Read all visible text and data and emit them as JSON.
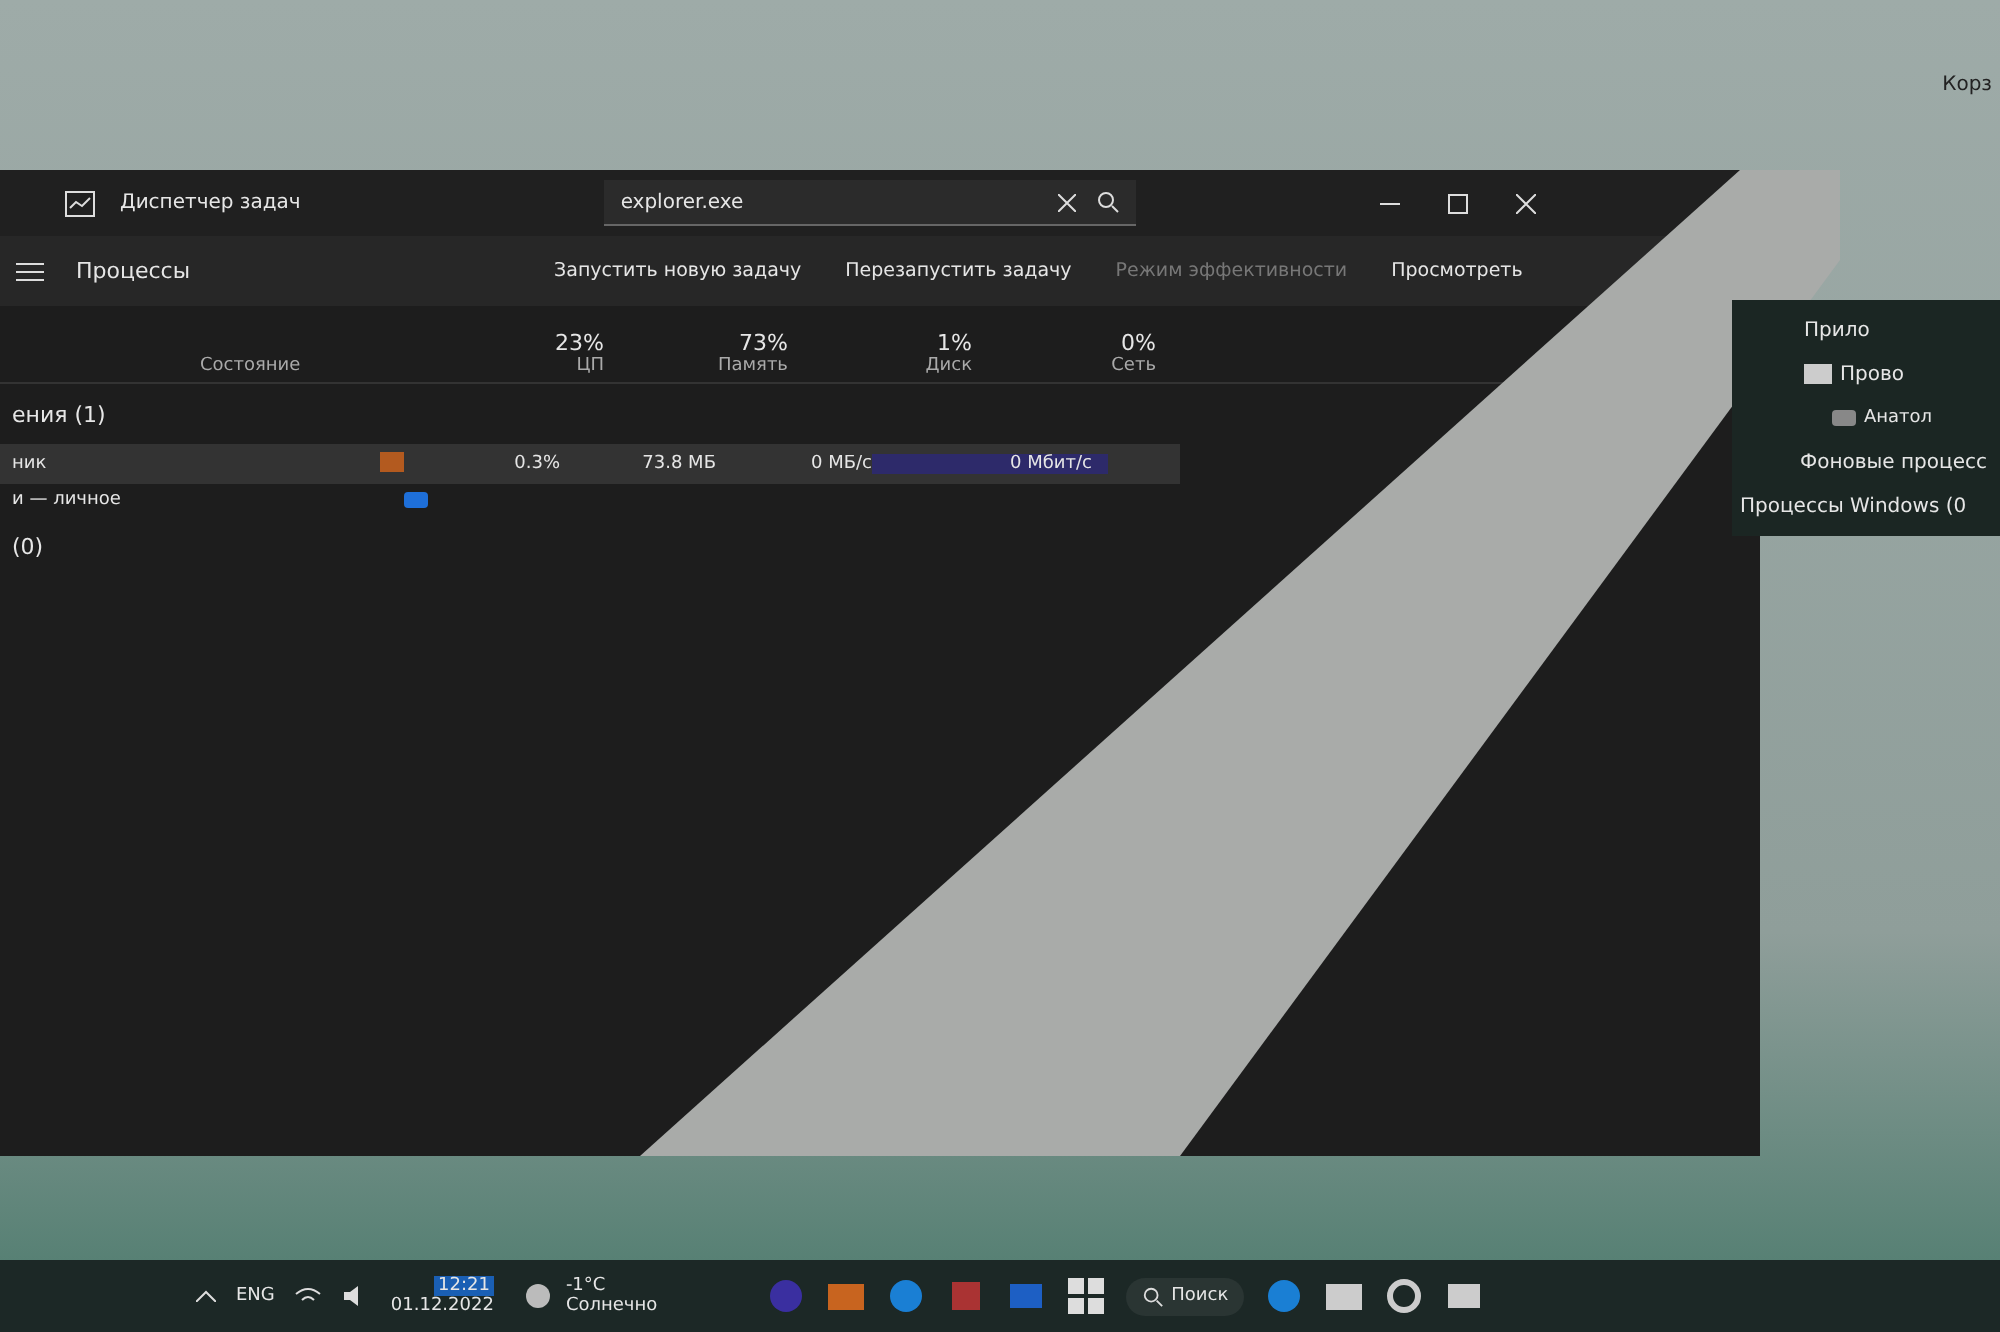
{
  "desktop": {
    "icons": [
      {
        "label": "Корз"
      }
    ]
  },
  "window": {
    "title": "Диспетчер задач",
    "search": {
      "value": "explorer.exe"
    },
    "page_title": "Процессы",
    "toolbar": [
      {
        "label": "Запустить новую задачу",
        "disabled": false
      },
      {
        "label": "Перезапустить задачу",
        "disabled": false
      },
      {
        "label": "Режим эффективности",
        "disabled": true
      },
      {
        "label": "Просмотреть",
        "disabled": false
      }
    ],
    "columns": [
      {
        "label": "Состояние"
      },
      {
        "label": "ЦП",
        "usage": "23%"
      },
      {
        "label": "Память",
        "usage": "73%"
      },
      {
        "label": "Диск",
        "usage": "1%"
      },
      {
        "label": "Сеть",
        "usage": "0%"
      }
    ],
    "groups": [
      {
        "label": "ения (1)",
        "rows": [
          {
            "name": "ник",
            "selected": true,
            "cells": [
              "0.3%",
              "73.8 МБ",
              "0 МБ/с",
              "0 Мбит/с"
            ],
            "children": [
              {
                "name": "и — личное"
              }
            ]
          }
        ]
      },
      {
        "label": "(0)"
      }
    ]
  },
  "side_panel": {
    "items": [
      {
        "label": "Прило",
        "kind": "group"
      },
      {
        "label": "Прово",
        "kind": "row"
      },
      {
        "label": "Анатол",
        "kind": "child"
      },
      {
        "label": "Фоновые процесс",
        "kind": "group"
      },
      {
        "label": "Процессы Windows (0",
        "kind": "group"
      }
    ]
  },
  "taskbar": {
    "language": "ENG",
    "time": "12:21",
    "date": "01.12.2022",
    "weather": {
      "temp": "-1°C",
      "text": "Солнечно"
    },
    "search": "Поиск"
  }
}
